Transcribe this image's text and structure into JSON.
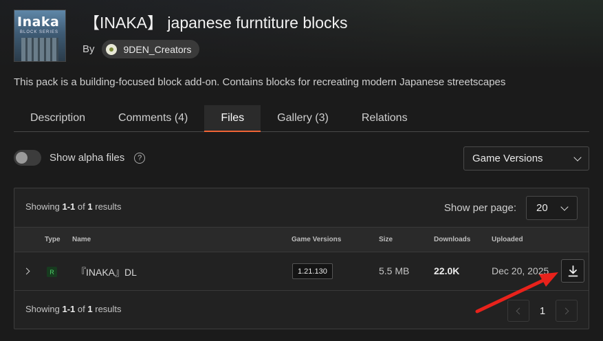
{
  "project": {
    "title": "【INAKA】 japanese furntiture blocks",
    "by_label": "By",
    "author": "9DEN_Creators",
    "logo_text": "Inaka",
    "logo_subtext": "BLOCK SERIES",
    "description": "This pack is a building-focused block add-on. Contains blocks for recreating modern Japanese streetscapes"
  },
  "tabs": [
    {
      "label": "Description"
    },
    {
      "label": "Comments (4)"
    },
    {
      "label": "Files",
      "active": true
    },
    {
      "label": "Gallery (3)"
    },
    {
      "label": "Relations"
    }
  ],
  "filters": {
    "alpha_label": "Show alpha files",
    "help_glyph": "?",
    "game_versions_label": "Game Versions"
  },
  "results": {
    "prefix": "Showing",
    "range": "1-1",
    "of": "of",
    "total": "1",
    "suffix": "results",
    "per_page_label": "Show per page:",
    "per_page_value": "20"
  },
  "table": {
    "columns": [
      "Type",
      "Name",
      "Game Versions",
      "Size",
      "Downloads",
      "Uploaded"
    ],
    "rows": [
      {
        "type_badge": "R",
        "name": "『INAKA』DL",
        "game_version": "1.21.130",
        "size": "5.5 MB",
        "downloads": "22.0K",
        "uploaded": "Dec 20, 2025"
      }
    ]
  },
  "pagination": {
    "current_page": "1"
  },
  "colors": {
    "accent": "#f16436",
    "annotation_arrow": "#e8221b",
    "release_badge": "#4fd16a"
  },
  "icons": [
    "help-icon",
    "chevron-down-icon",
    "download-icon",
    "chevron-right-icon",
    "chevron-left-icon",
    "release-badge"
  ]
}
